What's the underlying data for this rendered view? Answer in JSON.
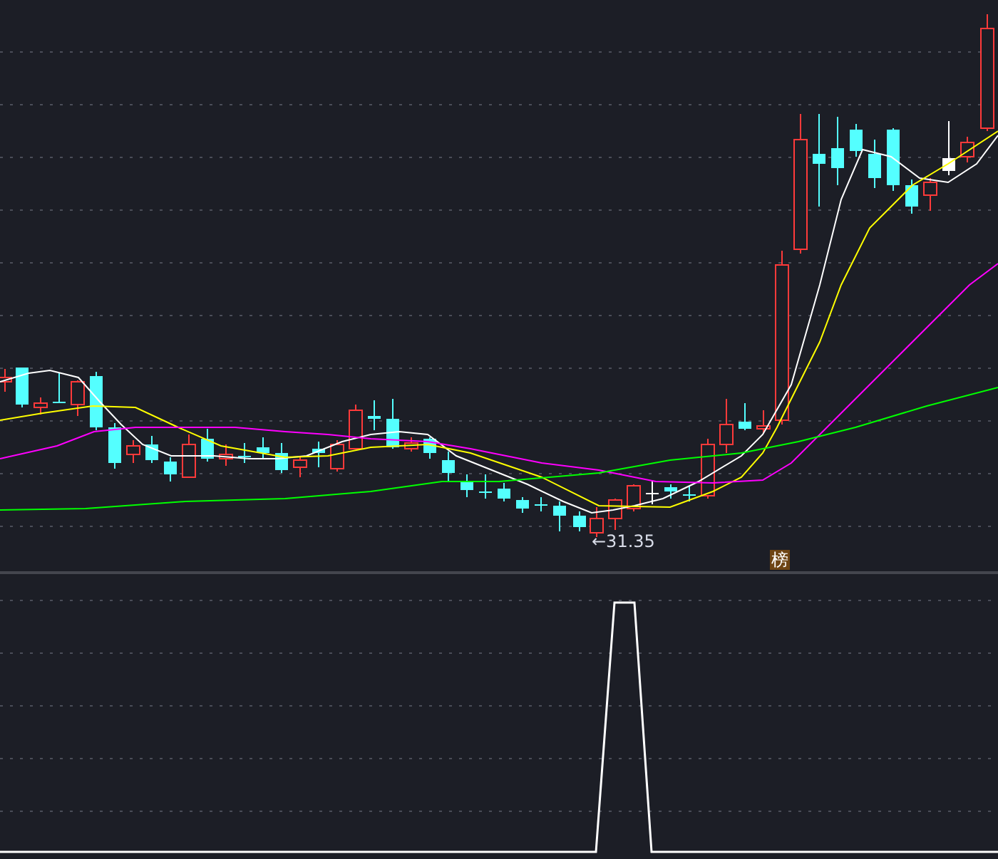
{
  "price_chart": {
    "low_marker": "←31.35",
    "badge": "榜"
  }
}
